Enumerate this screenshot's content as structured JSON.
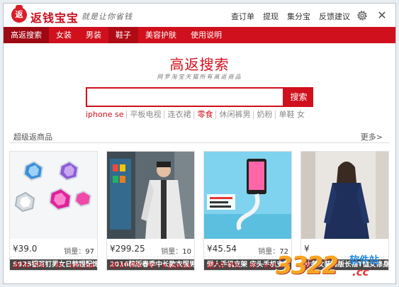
{
  "app": {
    "logo_glyph": "返",
    "name": "返钱宝宝",
    "slogan": "就是让你省钱"
  },
  "top_links": [
    "查订单",
    "提现",
    "集分宝",
    "反馈建议"
  ],
  "nav": [
    {
      "label": "高返搜索",
      "state": "active"
    },
    {
      "label": "女装",
      "state": ""
    },
    {
      "label": "男装",
      "state": ""
    },
    {
      "label": "鞋子",
      "state": "hl"
    },
    {
      "label": "美容护肤",
      "state": ""
    },
    {
      "label": "使用说明",
      "state": ""
    }
  ],
  "search": {
    "title": "高返搜索",
    "subtitle": "网罗淘宝天猫所有高返商品",
    "button": "搜索",
    "hot_words": [
      "iphone se",
      "平板电视",
      "连衣裙",
      "零食",
      "休闲裤男",
      "奶粉",
      "单鞋 女"
    ]
  },
  "section": {
    "title": "超级返商品",
    "more": "更多>"
  },
  "products": [
    {
      "caption": "S925银耳钉男女日韩银配饰",
      "price": "¥39.0",
      "sales_label": "销量：",
      "sales": "97",
      "rebate_pct": "返56.5%",
      "rebate_amt": "约：¥22.04",
      "img": "earrings"
    },
    {
      "caption": "2016韩版春季中长款衣服男",
      "price": "¥299.25",
      "sales_label": "销量：",
      "sales": "10",
      "rebate_pct": "返50.0%",
      "rebate_amt": "约：¥149.63",
      "img": "jacket"
    },
    {
      "caption": "懒人手机支架 床头手机支架",
      "price": "¥45.54",
      "sales_label": "销量：",
      "sales": "72",
      "rebate_pct": "返50.0%",
      "rebate_amt": "约：¥22.77",
      "img": "phone"
    },
    {
      "caption": "秋冬女装韩版长袖T恤女修身",
      "price": "¥",
      "sales_label": "",
      "sales": "",
      "rebate_pct": "返",
      "rebate_amt": "",
      "img": "sweater"
    }
  ],
  "watermark": {
    "num": "3322",
    "text": "软件站",
    "cc": ".cc"
  },
  "colors": {
    "brand_red": "#d0101c",
    "nav_active": "#9e0812",
    "caption_bg": "#000000"
  }
}
